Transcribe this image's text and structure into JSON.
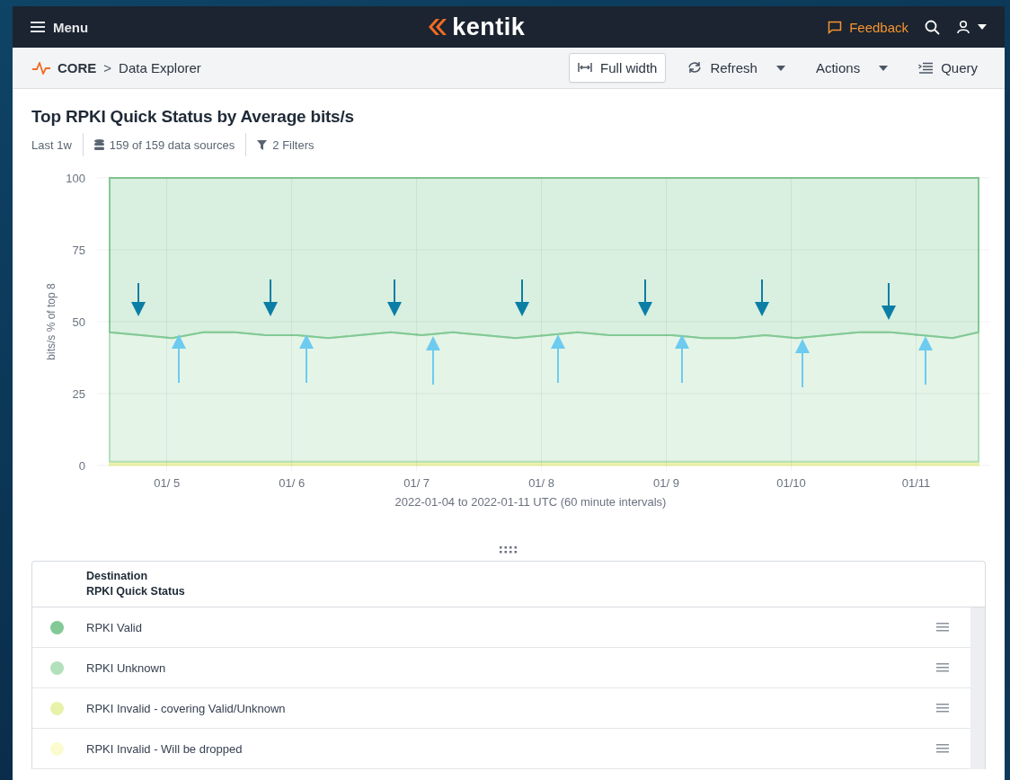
{
  "top_bar": {
    "menu_label": "Menu",
    "logo_text": "kentik",
    "feedback_label": "Feedback"
  },
  "toolbar": {
    "breadcrumb": [
      {
        "label": "CORE",
        "kind": "root"
      },
      {
        "label": "Data Explorer",
        "kind": "page"
      }
    ],
    "separator": ">",
    "actions": [
      {
        "label": "Full width",
        "kind": "full-width",
        "caret": false,
        "outlined": true
      },
      {
        "label": "Refresh",
        "kind": "refresh",
        "caret": true,
        "outlined": false
      },
      {
        "label": "Actions",
        "kind": "none",
        "caret": true,
        "outlined": false
      },
      {
        "label": "Query",
        "kind": "query",
        "caret": false,
        "outlined": false
      }
    ]
  },
  "panel": {
    "title": "Top RPKI Quick Status by Average bits/s",
    "meta": [
      {
        "kind": "time",
        "label": "Last 1w"
      },
      {
        "kind": "sources",
        "label": "159 of 159 data sources"
      },
      {
        "kind": "filters",
        "label": "2 Filters"
      }
    ],
    "chart_data": {
      "type": "area",
      "stacked": true,
      "xlabel": "2022-01-04 to 2022-01-11 UTC (60 minute intervals)",
      "ylabel": "bits/s % of top 8",
      "x": [
        "2022-01-04T13:00",
        "2022-01-04T19:00",
        "2022-01-05T01:00",
        "2022-01-05T07:00",
        "2022-01-05T13:00",
        "2022-01-05T19:00",
        "2022-01-06T01:00",
        "2022-01-06T07:00",
        "2022-01-06T13:00",
        "2022-01-06T19:00",
        "2022-01-07T01:00",
        "2022-01-07T07:00",
        "2022-01-07T13:00",
        "2022-01-07T19:00",
        "2022-01-08T01:00",
        "2022-01-08T07:00",
        "2022-01-08T13:00",
        "2022-01-08T19:00",
        "2022-01-09T01:00",
        "2022-01-09T07:00",
        "2022-01-09T13:00",
        "2022-01-09T19:00",
        "2022-01-10T01:00",
        "2022-01-10T07:00",
        "2022-01-10T13:00",
        "2022-01-10T19:00",
        "2022-01-11T01:00",
        "2022-01-11T07:00",
        "2022-01-11T12:00"
      ],
      "xlim": [
        "2022-01-04T13:00",
        "2022-01-11T12:00"
      ],
      "ylim": [
        0,
        100
      ],
      "xticks": [
        {
          "value": "2022-01-05T00:00",
          "label": "01/ 5"
        },
        {
          "value": "2022-01-06T00:00",
          "label": "01/ 6"
        },
        {
          "value": "2022-01-07T00:00",
          "label": "01/ 7"
        },
        {
          "value": "2022-01-08T00:00",
          "label": "01/ 8"
        },
        {
          "value": "2022-01-09T00:00",
          "label": "01/ 9"
        },
        {
          "value": "2022-01-10T00:00",
          "label": "01/10"
        },
        {
          "value": "2022-01-11T00:00",
          "label": "01/11"
        }
      ],
      "yticks": [
        0,
        25,
        50,
        75,
        100
      ],
      "grid": true,
      "series": [
        {
          "name": "RPKI Invalid - Will be dropped",
          "color": "#fbfbd0",
          "values": [
            0.3,
            0.3,
            0.3,
            0.3,
            0.3,
            0.3,
            0.3,
            0.3,
            0.3,
            0.3,
            0.3,
            0.3,
            0.3,
            0.3,
            0.3,
            0.3,
            0.3,
            0.3,
            0.3,
            0.3,
            0.3,
            0.3,
            0.3,
            0.3,
            0.3,
            0.3,
            0.3,
            0.3,
            0.3
          ]
        },
        {
          "name": "RPKI Invalid - covering Valid/Unknown",
          "color": "#e8f2a8",
          "values": [
            1,
            1,
            1,
            1,
            1,
            1,
            1,
            1,
            1,
            1,
            1,
            1,
            1,
            1,
            1,
            1,
            1,
            1,
            1,
            1,
            1,
            1,
            1,
            1,
            1,
            1,
            1,
            1,
            1
          ]
        },
        {
          "name": "RPKI Unknown",
          "color": "#b2e0bb",
          "values": [
            45,
            44,
            43,
            45,
            45,
            44,
            44,
            43,
            44,
            45,
            44,
            45,
            44,
            43,
            44,
            45,
            44,
            44,
            44,
            43,
            43,
            44,
            43,
            44,
            45,
            45,
            44,
            43,
            45
          ]
        },
        {
          "name": "RPKI Valid",
          "color": "#82c995",
          "values": [
            53.7,
            54.7,
            55.7,
            53.7,
            53.7,
            54.7,
            54.7,
            55.7,
            54.7,
            53.7,
            54.7,
            53.7,
            54.7,
            55.7,
            54.7,
            53.7,
            54.7,
            54.7,
            54.7,
            55.7,
            55.7,
            54.7,
            55.7,
            54.7,
            53.7,
            53.7,
            54.7,
            55.7,
            53.7
          ]
        }
      ]
    },
    "arrows": [
      {
        "kind": "down"
      },
      {
        "kind": "up"
      },
      {
        "kind": "down"
      },
      {
        "kind": "up"
      },
      {
        "kind": "down"
      },
      {
        "kind": "up"
      },
      {
        "kind": "down"
      },
      {
        "kind": "up"
      },
      {
        "kind": "down"
      },
      {
        "kind": "up"
      },
      {
        "kind": "down"
      },
      {
        "kind": "up"
      },
      {
        "kind": "down"
      },
      {
        "kind": "up"
      }
    ]
  },
  "table": {
    "heading": [
      "Destination",
      "RPKI Quick Status"
    ]
  }
}
